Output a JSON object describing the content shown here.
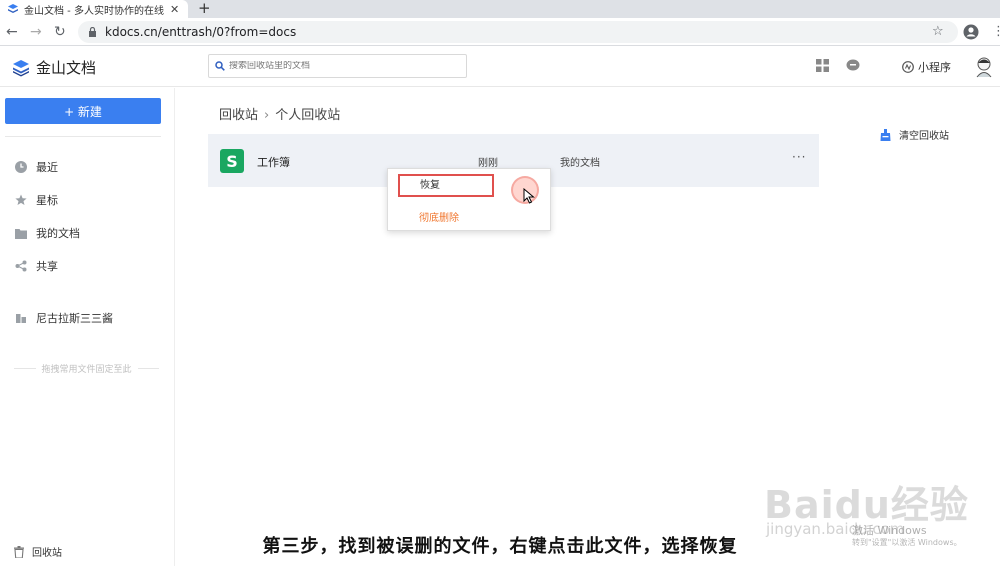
{
  "browser": {
    "tab_title": "金山文档 - 多人实时协作的在线",
    "new_tab": "+",
    "url": "kdocs.cn/enttrash/0?from=docs"
  },
  "header": {
    "app_name": "金山文档",
    "search_placeholder": "搜索回收站里的文档",
    "mini_program": "小程序"
  },
  "sidebar": {
    "new_button": "+ 新建",
    "items": [
      {
        "label": "最近",
        "icon": "clock-icon"
      },
      {
        "label": "星标",
        "icon": "star-icon"
      },
      {
        "label": "我的文档",
        "icon": "folder-icon"
      },
      {
        "label": "共享",
        "icon": "share-icon"
      },
      {
        "label": "尼古拉斯三三酱",
        "icon": "team-icon"
      }
    ],
    "pin_hint": "拖拽常用文件固定至此",
    "recycle_bin": "回收站"
  },
  "main": {
    "breadcrumb": [
      "回收站",
      "个人回收站"
    ],
    "empty_bin": "清空回收站",
    "file": {
      "icon_letter": "S",
      "name": "工作簿",
      "deleted_time": "刚刚",
      "location": "我的文档",
      "more": "···"
    }
  },
  "context_menu": {
    "restore": "恢复",
    "delete_forever": "彻底删除"
  },
  "overlay": {
    "caption": "第三步，找到被误删的文件，右键点击此文件，选择恢复",
    "watermark_logo": "Baidu经验",
    "watermark_url": "jingyan.baidu.com",
    "win_activate": "激活 Windows",
    "win_activate_sub": "转到\"设置\"以激活 Windows。"
  },
  "colors": {
    "primary": "#3a7ff0",
    "sheet_green": "#1aa761",
    "highlight_red": "#e0504d",
    "delete_orange": "#f0762e",
    "row_bg": "#eef1f6"
  }
}
